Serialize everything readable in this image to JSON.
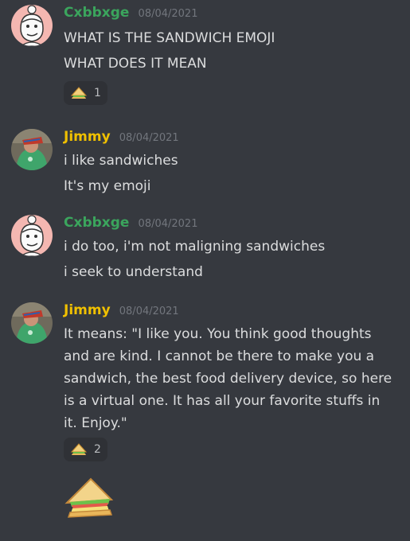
{
  "colors": {
    "background": "#36393f",
    "cxbbxge_name": "#3ba55d",
    "jimmy_name": "#f0c000",
    "timestamp": "#72767d",
    "text": "#dcddde",
    "reaction_bg": "#2f3136"
  },
  "messages": [
    {
      "author": "Cxbbxge",
      "timestamp": "08/04/2021",
      "avatar_icon": "cartoon-face-avatar",
      "lines": [
        "WHAT IS THE SANDWICH EMOJI",
        "WHAT DOES IT MEAN"
      ],
      "reaction": {
        "emoji_icon": "sandwich-icon",
        "count": "1"
      }
    },
    {
      "author": "Jimmy",
      "timestamp": "08/04/2021",
      "avatar_icon": "photo-avatar",
      "lines": [
        "i like sandwiches",
        "It's my emoji"
      ]
    },
    {
      "author": "Cxbbxge",
      "timestamp": "08/04/2021",
      "avatar_icon": "cartoon-face-avatar",
      "lines": [
        "i do too, i'm not maligning sandwiches",
        "i seek to understand"
      ]
    },
    {
      "author": "Jimmy",
      "timestamp": "08/04/2021",
      "avatar_icon": "photo-avatar",
      "text": "It means: \"I like you. You think good thoughts and are kind. I cannot be there to make you a sandwich, the best food delivery device, so here is a virtual one. It has all your favorite stuffs in it. Enjoy.\"",
      "reaction": {
        "emoji_icon": "sandwich-icon",
        "count": "2"
      },
      "attachment_icon": "large-sandwich-emoji"
    }
  ]
}
